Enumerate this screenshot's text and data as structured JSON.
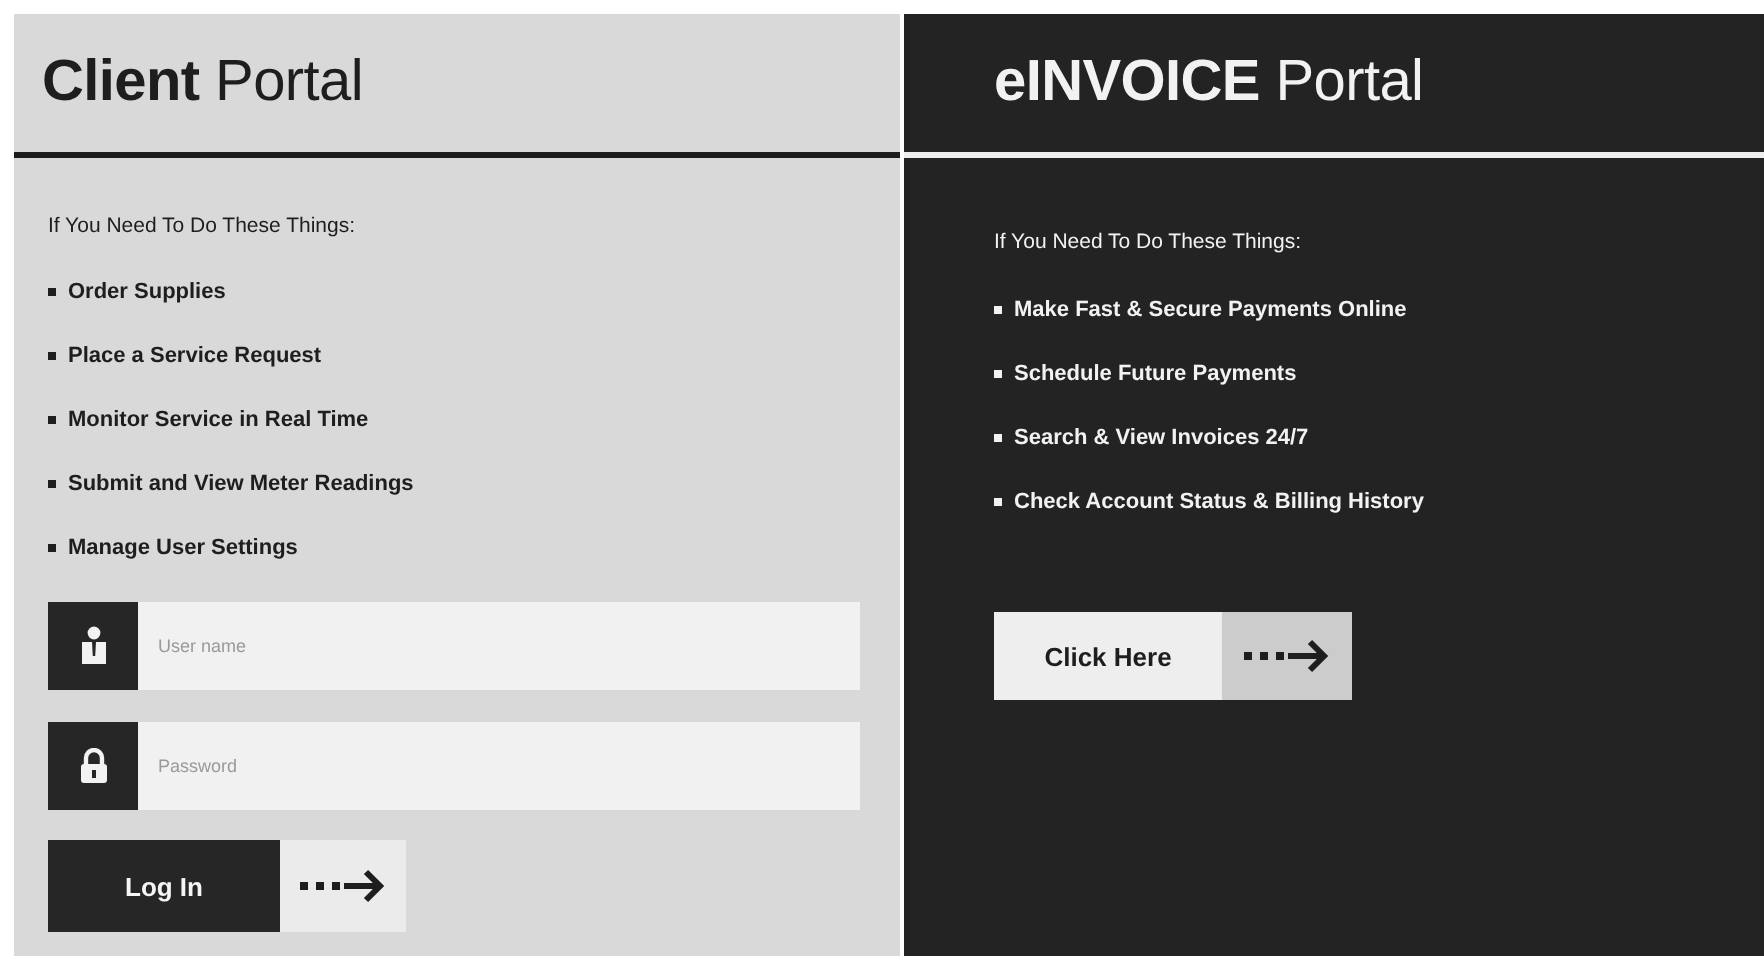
{
  "client_portal": {
    "title": "**Client** Portal",
    "intro": "If You Need To Do These Things:",
    "items": [
      "Order Supplies",
      "Place a Service Request",
      "Monitor Service in Real Time",
      "Submit and View Meter Readings",
      "Manage User Settings"
    ],
    "fields": [
      {
        "kind": "user",
        "placeholder": "User name"
      },
      {
        "kind": "lock",
        "placeholder": "Password"
      }
    ],
    "button": "Log In"
  },
  "einvoice_portal": {
    "title": "**eINVOICE** Portal",
    "intro": "If You Need To Do These Things:",
    "items": [
      "Make Fast & Secure Payments Online",
      "Schedule Future Payments",
      "Search & View Invoices 24/7",
      "Check Account Status & Billing History"
    ],
    "button": "Click Here"
  }
}
